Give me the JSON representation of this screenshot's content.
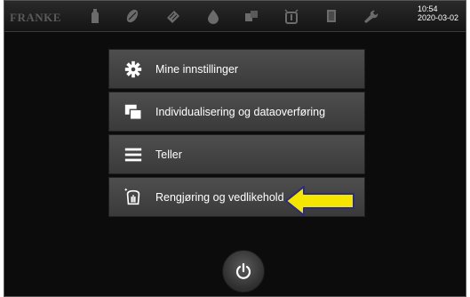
{
  "topbar": {
    "logo": "FRANKE",
    "time": "10:54",
    "date": "2020-03-02",
    "icons": [
      "bottle-icon",
      "bean-icon",
      "milk-carton-icon",
      "drop-icon",
      "cups-icon",
      "touch-icon",
      "box-icon",
      "wrench-icon"
    ]
  },
  "menu": {
    "items": [
      {
        "label": "Mine innstillinger",
        "icon": "gear-icon"
      },
      {
        "label": "Individualisering og dataoverføring",
        "icon": "transfer-icon"
      },
      {
        "label": "Teller",
        "icon": "hamburger-icon"
      },
      {
        "label": "Rengjøring og vedlikehold",
        "icon": "cleaning-icon"
      }
    ]
  },
  "annotation": {
    "arrow_color": "#f4e600",
    "arrow_outline": "#2a2a8c"
  },
  "power": {
    "icon": "power-icon"
  }
}
